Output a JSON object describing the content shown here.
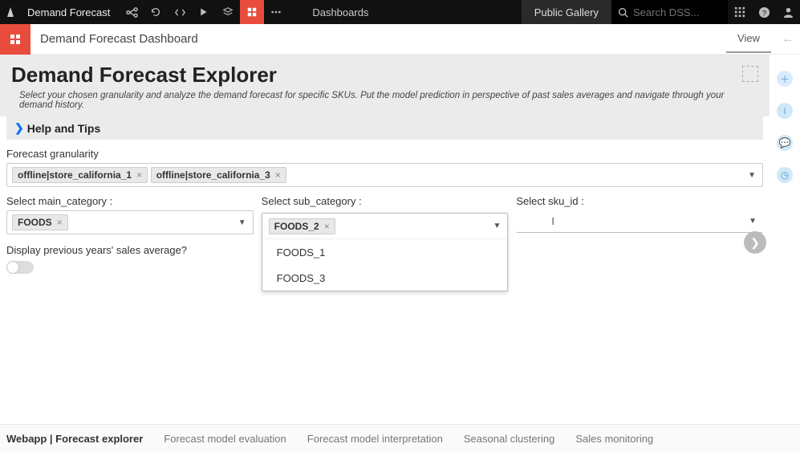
{
  "topbar": {
    "project_name": "Demand Forecast",
    "breadcrumb": "Dashboards",
    "gallery_label": "Public Gallery",
    "search_placeholder": "Search DSS..."
  },
  "subhead": {
    "title": "Demand Forecast Dashboard",
    "view_label": "View"
  },
  "panel": {
    "title": "Demand Forecast Explorer",
    "description": "Select your chosen granularity and analyze the demand forecast for specific SKUs. Put the model prediction in perspective of past sales averages and navigate through your demand history.",
    "help_label": "Help and Tips"
  },
  "form": {
    "granularity_label": "Forecast granularity",
    "granularity_chips": [
      "offline|store_california_1",
      "offline|store_california_3"
    ],
    "main_cat_label": "Select main_category :",
    "main_cat_chips": [
      "FOODS"
    ],
    "sub_cat_label": "Select sub_category :",
    "sub_cat_selected": "FOODS_2",
    "sub_cat_options": [
      "FOODS_1",
      "FOODS_3"
    ],
    "sku_label": "Select sku_id :",
    "toggle_label": "Display previous years' sales average?"
  },
  "bottom_tabs": [
    "Webapp | Forecast explorer",
    "Forecast model evaluation",
    "Forecast model interpretation",
    "Seasonal clustering",
    "Sales monitoring"
  ],
  "bottom_active_index": 0
}
